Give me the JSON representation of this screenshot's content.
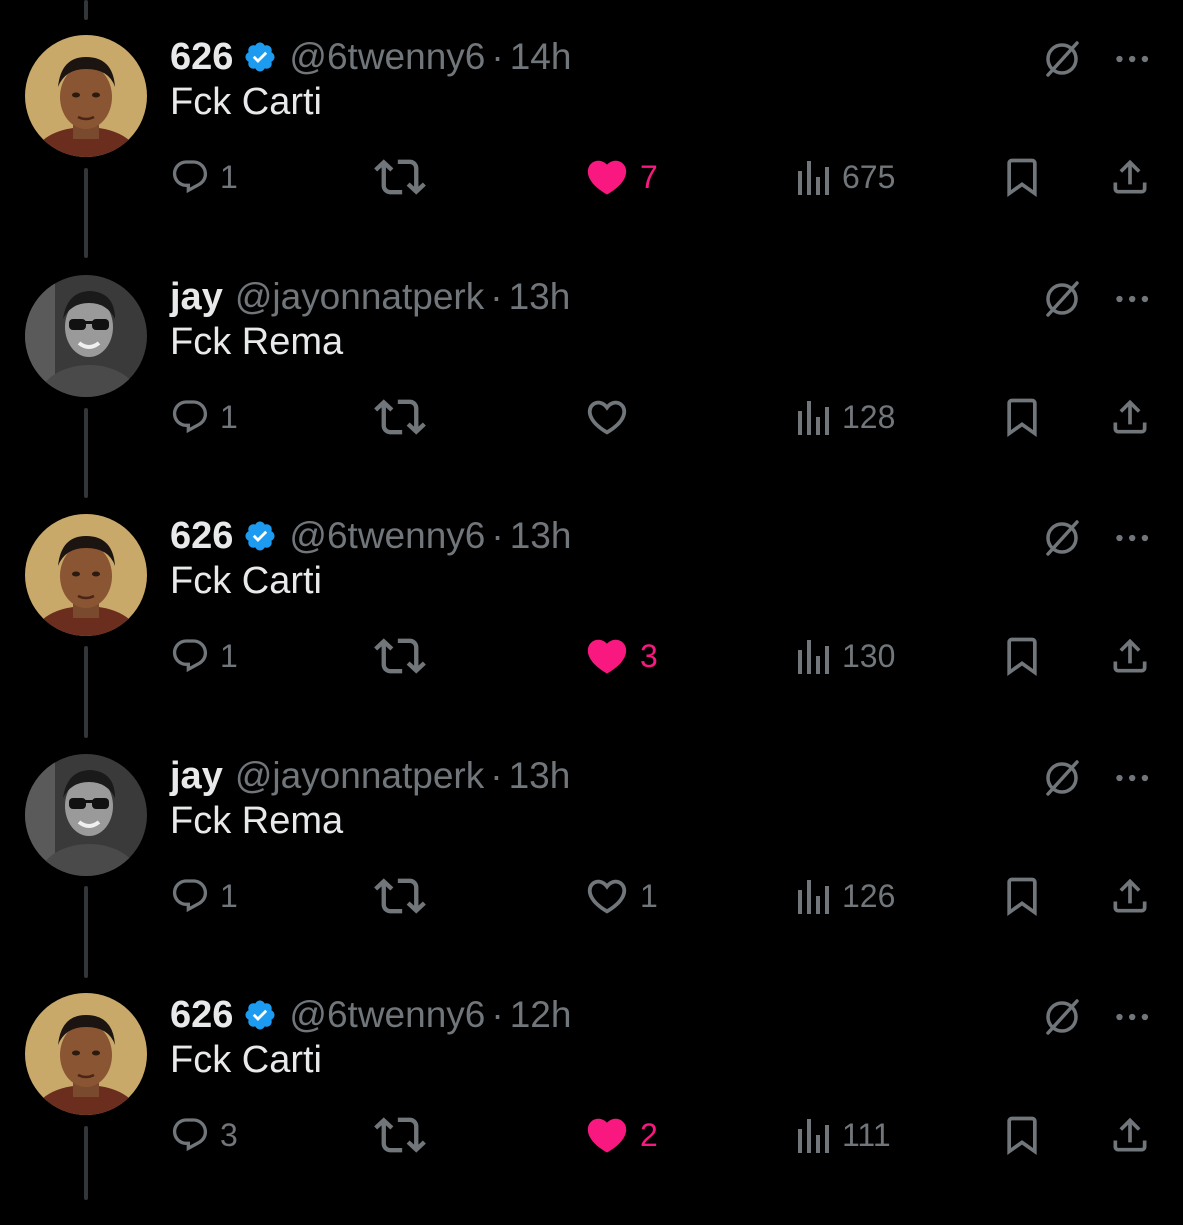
{
  "colors": {
    "background": "#000000",
    "text": "#e7e9ea",
    "muted": "#71767b",
    "like": "#f91880",
    "verified": "#1d9bf0"
  },
  "icons": {
    "reply": "reply-icon",
    "repost": "repost-icon",
    "like": "heart-icon",
    "views": "views-icon",
    "bookmark": "bookmark-icon",
    "share": "share-icon",
    "grok": "grok-icon",
    "more": "more-icon"
  },
  "tweets": [
    {
      "name": "626",
      "verified": true,
      "handle": "@6twenny6",
      "time": "14h",
      "text": "Fck Carti",
      "replies": "1",
      "likes": "7",
      "liked": true,
      "views": "675",
      "avatar": "avatar-626"
    },
    {
      "name": "jay",
      "verified": false,
      "handle": "@jayonnatperk",
      "time": "13h",
      "text": "Fck Rema",
      "replies": "1",
      "likes": "",
      "liked": false,
      "views": "128",
      "avatar": "avatar-jay"
    },
    {
      "name": "626",
      "verified": true,
      "handle": "@6twenny6",
      "time": "13h",
      "text": "Fck Carti",
      "replies": "1",
      "likes": "3",
      "liked": true,
      "views": "130",
      "avatar": "avatar-626"
    },
    {
      "name": "jay",
      "verified": false,
      "handle": "@jayonnatperk",
      "time": "13h",
      "text": "Fck Rema",
      "replies": "1",
      "likes": "1",
      "liked": false,
      "views": "126",
      "avatar": "avatar-jay"
    },
    {
      "name": "626",
      "verified": true,
      "handle": "@6twenny6",
      "time": "12h",
      "text": "Fck Carti",
      "replies": "3",
      "likes": "2",
      "liked": true,
      "views": "111",
      "avatar": "avatar-626"
    }
  ]
}
